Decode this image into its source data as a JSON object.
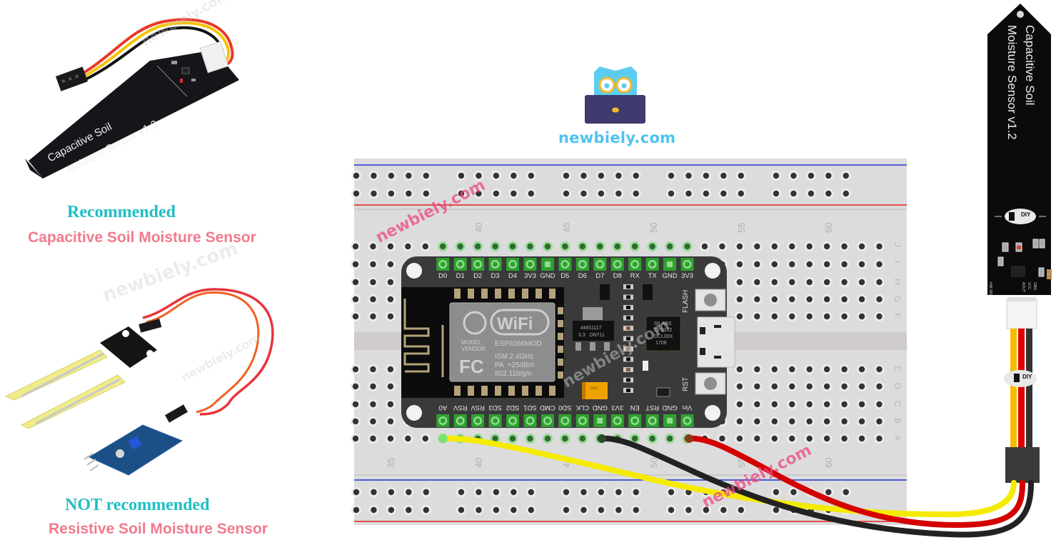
{
  "logo": {
    "brand_text": "newbiely.com",
    "colors": {
      "owl": "#5ccdf0",
      "glasses": "#f5b92e",
      "laptop": "#3f3b6e",
      "text": "#4fc3ee"
    }
  },
  "left_panel": {
    "recommended": {
      "heading": "Recommended",
      "subtitle": "Capacitive Soil Moisture Sensor",
      "board_text_line1": "Capacitive Soil",
      "board_text_line2": "Moisture Sensor v1.2"
    },
    "not_recommended": {
      "heading": "NOT recommended",
      "subtitle": "Resistive Soil Moisture Sensor"
    },
    "heading_color": "#1fbfc4",
    "subtitle_color": "#f07b8e"
  },
  "breadboard": {
    "column_numbers_top": [
      "40",
      "45",
      "50",
      "55",
      "60"
    ],
    "column_numbers_bottom": [
      "35",
      "40",
      "45",
      "50",
      "55",
      "60"
    ],
    "row_letters_top": [
      "J",
      "I",
      "H",
      "G",
      "F"
    ],
    "row_letters_bottom": [
      "E",
      "D",
      "C",
      "B",
      "A"
    ],
    "rail_colors": {
      "positive": "#e02020",
      "negative": "#2030d0"
    }
  },
  "nodemcu": {
    "top_pins": [
      "D0",
      "D1",
      "D2",
      "D3",
      "D4",
      "3V3",
      "GND",
      "D5",
      "D6",
      "D7",
      "D8",
      "RX",
      "TX",
      "GND",
      "3V3"
    ],
    "bottom_pins": [
      "A0",
      "RSV",
      "RSV",
      "SD3",
      "SD2",
      "SD1",
      "CMD",
      "SD0",
      "CLK",
      "GND",
      "3V3",
      "EN",
      "RST",
      "GND",
      "Vin"
    ],
    "module": {
      "wifi_label": "WiFi",
      "model_label": "MODEL",
      "vendor_label": "VENDOR",
      "chip_name": "ESP8266MOD",
      "fcc_label": "FC",
      "spec_1": "ISM 2.4GHz",
      "spec_2": "PA  +25dBm",
      "spec_3": "802.11b/g/n"
    },
    "regulator": {
      "line1": "AMS1117",
      "line2": "3.3   DN711"
    },
    "usb_chip": {
      "line1": "SILABS",
      "line2": "CP2102",
      "line3": "DCL00X",
      "line4": "1708"
    },
    "buttons": {
      "flash": "FLASH",
      "reset": "RST"
    },
    "capacitor_label": "106C"
  },
  "wires": [
    {
      "name": "signal",
      "from_pin": "A0",
      "to_pin": "AOUT",
      "color": "#f5eb00"
    },
    {
      "name": "ground",
      "from_pin": "GND",
      "to_pin": "GND",
      "color": "#222222"
    },
    {
      "name": "power",
      "from_pin": "Vin",
      "to_pin": "VCC",
      "color": "#d40000"
    }
  ],
  "sensor_right": {
    "text_line1": "Capacitive Soil",
    "text_line2": "Moisture Sensor v1.2",
    "logo_text": "DIY",
    "pins": [
      "AOUT",
      "VCC",
      "GND"
    ],
    "model_label": "HW-390"
  },
  "watermarks": [
    "newbiely.com",
    "newbiely.com",
    "newbiely.com",
    "newbiely.com"
  ]
}
